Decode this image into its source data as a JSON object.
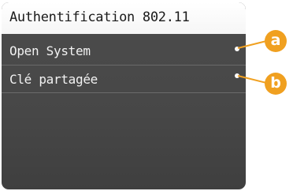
{
  "header": {
    "title": "Authentification 802.11"
  },
  "menu": {
    "items": [
      {
        "label": "Open System"
      },
      {
        "label": "Clé partagée"
      }
    ]
  },
  "callouts": [
    {
      "letter": "a"
    },
    {
      "letter": "b"
    }
  ],
  "colors": {
    "screen_bg": "#474747",
    "title_bg": "#ffffff",
    "accent": "#f0a020",
    "item_text": "#f2f2f2"
  }
}
